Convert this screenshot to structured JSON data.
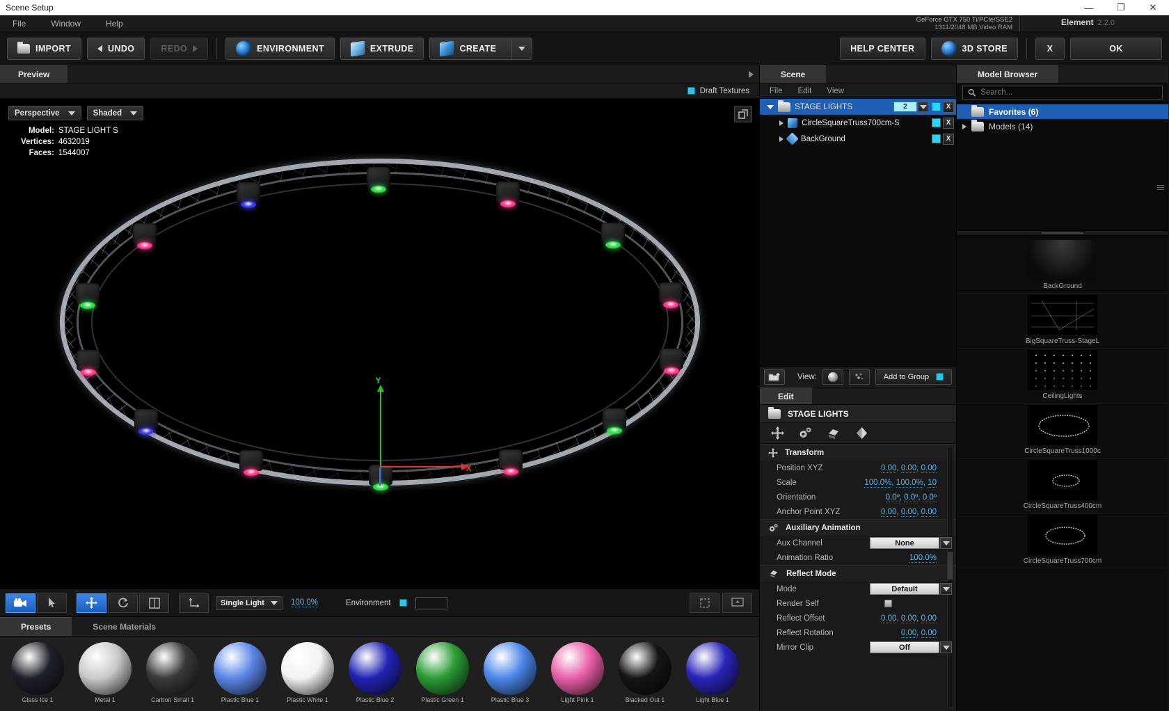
{
  "window": {
    "title": "Scene Setup",
    "minimize": "—",
    "maximize": "❐",
    "close": "✕"
  },
  "menubar": {
    "items": [
      "File",
      "Window",
      "Help"
    ],
    "gpu_name": "GeForce GTX 750 Ti/PCIe/SSE2",
    "gpu_ram": "1311/2048 MB Video RAM",
    "product": "Element",
    "version": "2.2.0"
  },
  "toolbar": {
    "import": "IMPORT",
    "undo": "UNDO",
    "redo": "REDO",
    "environment": "ENVIRONMENT",
    "extrude": "EXTRUDE",
    "create": "CREATE",
    "help_center": "HELP CENTER",
    "store": "3D STORE",
    "cancel": "X",
    "ok": "OK"
  },
  "preview": {
    "tab": "Preview",
    "draft_textures": "Draft Textures",
    "camera_mode": "Perspective",
    "shading_mode": "Shaded",
    "stats": {
      "model_label": "Model:",
      "model_value": "STAGE LIGHT S",
      "vertices_label": "Vertices:",
      "vertices_value": "4632019",
      "faces_label": "Faces:",
      "faces_value": "1544007"
    },
    "axis": {
      "x": "X",
      "y": "Y"
    },
    "bottom_tools": {
      "light_mode": "Single Light",
      "light_value": "100.0%",
      "environment_label": "Environment"
    }
  },
  "materials": {
    "tabs": [
      "Presets",
      "Scene Materials"
    ],
    "active_tab": "Presets",
    "items": [
      {
        "label": "Glass Ice 1",
        "color": "#1d2128"
      },
      {
        "label": "Metal 1",
        "color": "#c9c9c9"
      },
      {
        "label": "Carbon Small 1",
        "color": "#3a3a3a"
      },
      {
        "label": "Plastic Blue 1",
        "color": "#5b86e8"
      },
      {
        "label": "Plastic White 1",
        "color": "#f2f2f2"
      },
      {
        "label": "Plastic Blue 2",
        "color": "#2323b4"
      },
      {
        "label": "Plastic Green 1",
        "color": "#2a9b34"
      },
      {
        "label": "Plastic Blue 3",
        "color": "#4b87ea"
      },
      {
        "label": "Light Pink 1",
        "color": "#e85fa8"
      },
      {
        "label": "Blacked Out 1",
        "color": "#151515"
      },
      {
        "label": "Light Blue 1",
        "color": "#2a25b8"
      }
    ]
  },
  "scene": {
    "tab": "Scene",
    "menu": [
      "File",
      "Edit",
      "View"
    ],
    "tree": [
      {
        "name": "STAGE LIGHTS",
        "type": "folder",
        "selected": true,
        "count": "2",
        "close": "X"
      },
      {
        "name": "CircleSquareTruss700cm-S",
        "type": "cube",
        "selected": false,
        "close": "X"
      },
      {
        "name": "BackGround",
        "type": "diamond",
        "selected": false,
        "close": "X"
      }
    ],
    "view_label": "View:",
    "add_to_group": "Add to Group"
  },
  "edit": {
    "tab": "Edit",
    "object_name": "STAGE LIGHTS",
    "groups": [
      {
        "title": "Transform",
        "icon": "move-icon",
        "rows": [
          {
            "label": "Position XYZ",
            "value": "0.00,  0.00,  0.00",
            "kind": "number"
          },
          {
            "label": "Scale",
            "value": "100.0%,  100.0%,  10",
            "kind": "number"
          },
          {
            "label": "Orientation",
            "value": "0.0º,  0.0º,  0.0º",
            "kind": "number"
          },
          {
            "label": "Anchor Point XYZ",
            "value": "0.00,  0.00,  0.00",
            "kind": "number"
          }
        ]
      },
      {
        "title": "Auxiliary Animation",
        "icon": "gears-icon",
        "rows": [
          {
            "label": "Aux Channel",
            "value": "None",
            "kind": "dropdown"
          },
          {
            "label": "Animation Ratio",
            "value": "100.0%",
            "kind": "number"
          }
        ]
      },
      {
        "title": "Reflect Mode",
        "icon": "reflect-icon",
        "rows": [
          {
            "label": "Mode",
            "value": "Default",
            "kind": "dropdown"
          },
          {
            "label": "Render Self",
            "value": "",
            "kind": "checkbox"
          },
          {
            "label": "Reflect Offset",
            "value": "0.00,  0.00,  0.00",
            "kind": "number"
          },
          {
            "label": "Reflect Rotation",
            "value": "0.00,  0.00",
            "kind": "number"
          },
          {
            "label": "Mirror Clip",
            "value": "Off",
            "kind": "dropdown"
          }
        ]
      }
    ]
  },
  "model_browser": {
    "tab": "Model Browser",
    "search_placeholder": "Search...",
    "tree": [
      {
        "name": "Models (14)",
        "selected": false
      },
      {
        "name": "Favorites (6)",
        "selected": true
      }
    ],
    "thumbnails": [
      {
        "name": "BackGround",
        "kind": "gradient"
      },
      {
        "name": "BigSquareTruss-StageL",
        "kind": "truss"
      },
      {
        "name": "CeilingLights",
        "kind": "dots"
      },
      {
        "name": "CircleSquareTruss1000c",
        "kind": "ring-big"
      },
      {
        "name": "CircleSquareTruss400cm",
        "kind": "ring-small"
      },
      {
        "name": "CircleSquareTruss700cm",
        "kind": "ring-mid"
      }
    ]
  }
}
